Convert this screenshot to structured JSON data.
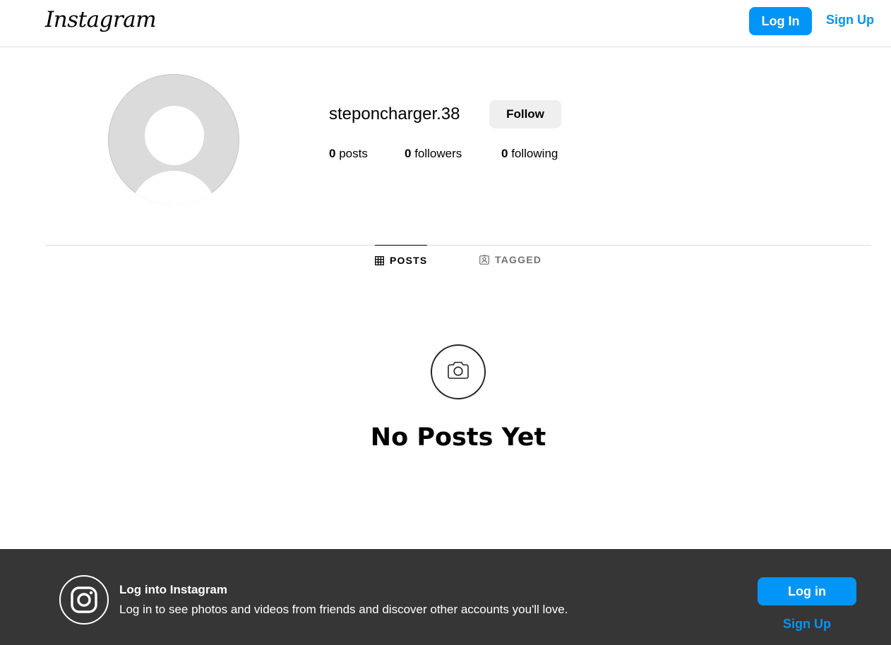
{
  "header": {
    "logo_text": "Instagram",
    "login_label": "Log In",
    "signup_label": "Sign Up"
  },
  "profile": {
    "username": "steponcharger.38",
    "follow_label": "Follow",
    "stats": {
      "posts_count": "0",
      "posts_label": "posts",
      "followers_count": "0",
      "followers_label": "followers",
      "following_count": "0",
      "following_label": "following"
    }
  },
  "tabs": [
    {
      "label": "POSTS",
      "icon": "grid-icon",
      "active": true
    },
    {
      "label": "TAGGED",
      "icon": "tagged-icon",
      "active": false
    }
  ],
  "empty_state": {
    "icon": "camera-icon",
    "title": "No Posts Yet"
  },
  "footer_banner": {
    "icon": "instagram-logo-icon",
    "title": "Log into Instagram",
    "text": "Log in to see photos and videos from friends and discover other accounts you'll love.",
    "login_label": "Log in",
    "signup_label": "Sign Up"
  },
  "colors": {
    "accent": "#0095f6",
    "follow_button_bg": "#efefef",
    "footer_bg": "#363636",
    "divider": "#dbdbdb"
  }
}
